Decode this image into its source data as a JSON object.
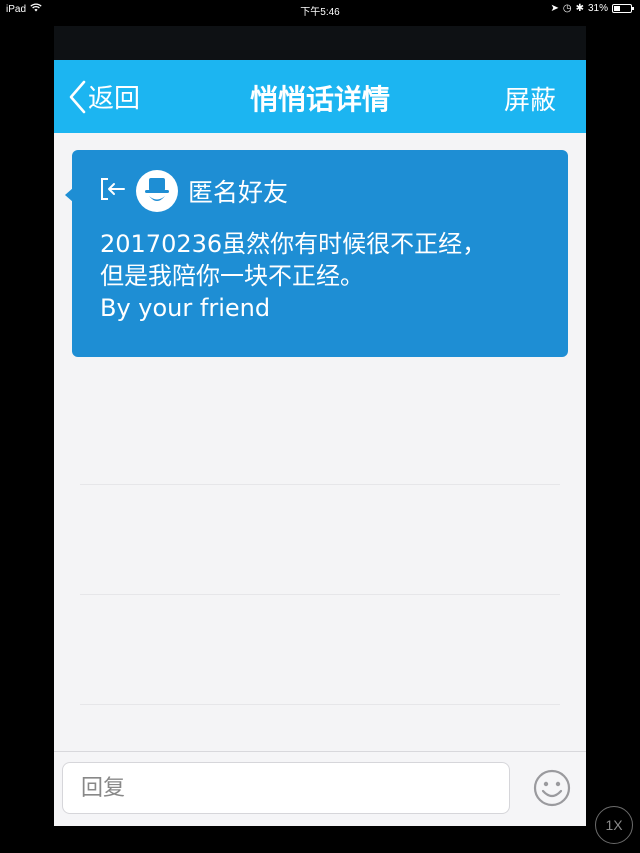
{
  "status_bar": {
    "device": "iPad",
    "time": "下午5:46",
    "battery": "31%",
    "battery_level": 0.31
  },
  "navbar": {
    "back_label": "返回",
    "title": "悄悄话详情",
    "right_action": "屏蔽"
  },
  "message": {
    "sender": "匿名好友",
    "lines": [
      "20170236虽然你有时候很不正经，",
      "但是我陪你一块不正经。",
      "By your friend"
    ]
  },
  "input_bar": {
    "placeholder": "回复"
  },
  "zoom": {
    "label": "1X"
  },
  "colors": {
    "navbar": "#1cb5f1",
    "card": "#1e8ed4",
    "background": "#f4f4f6"
  },
  "icons": [
    "wifi-icon",
    "back-chevron-icon",
    "exit-icon",
    "anonymous-avatar-icon",
    "emoji-icon",
    "battery-icon"
  ]
}
